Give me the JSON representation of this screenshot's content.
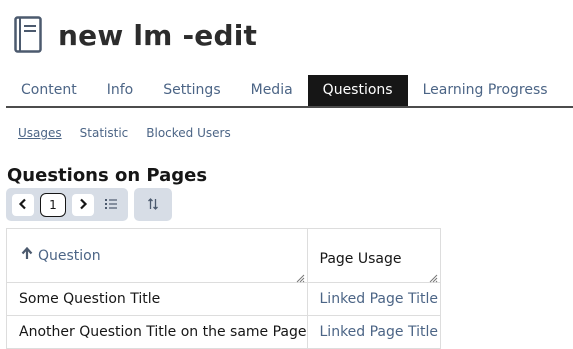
{
  "header": {
    "title": "new lm -edit",
    "icon": "book-icon"
  },
  "tabs": [
    {
      "label": "Content",
      "active": false
    },
    {
      "label": "Info",
      "active": false
    },
    {
      "label": "Settings",
      "active": false
    },
    {
      "label": "Media",
      "active": false
    },
    {
      "label": "Questions",
      "active": true
    },
    {
      "label": "Learning Progress",
      "active": false
    }
  ],
  "subtabs": [
    {
      "label": "Usages",
      "active": true
    },
    {
      "label": "Statistic",
      "active": false
    },
    {
      "label": "Blocked Users",
      "active": false
    }
  ],
  "section": {
    "title": "Questions on Pages"
  },
  "pagination": {
    "current_page": "1"
  },
  "table": {
    "columns": [
      {
        "label": "Question",
        "sorted": "ascending"
      },
      {
        "label": "Page Usage"
      }
    ],
    "rows": [
      {
        "question": "Some Question Title",
        "page": "Linked Page Title"
      },
      {
        "question": "Another Question Title on the same Page",
        "page": "Linked Page Title"
      }
    ]
  },
  "colors": {
    "link": "#4c6586",
    "active_tab_bg": "#161616",
    "control_bg": "#d7dde6"
  }
}
